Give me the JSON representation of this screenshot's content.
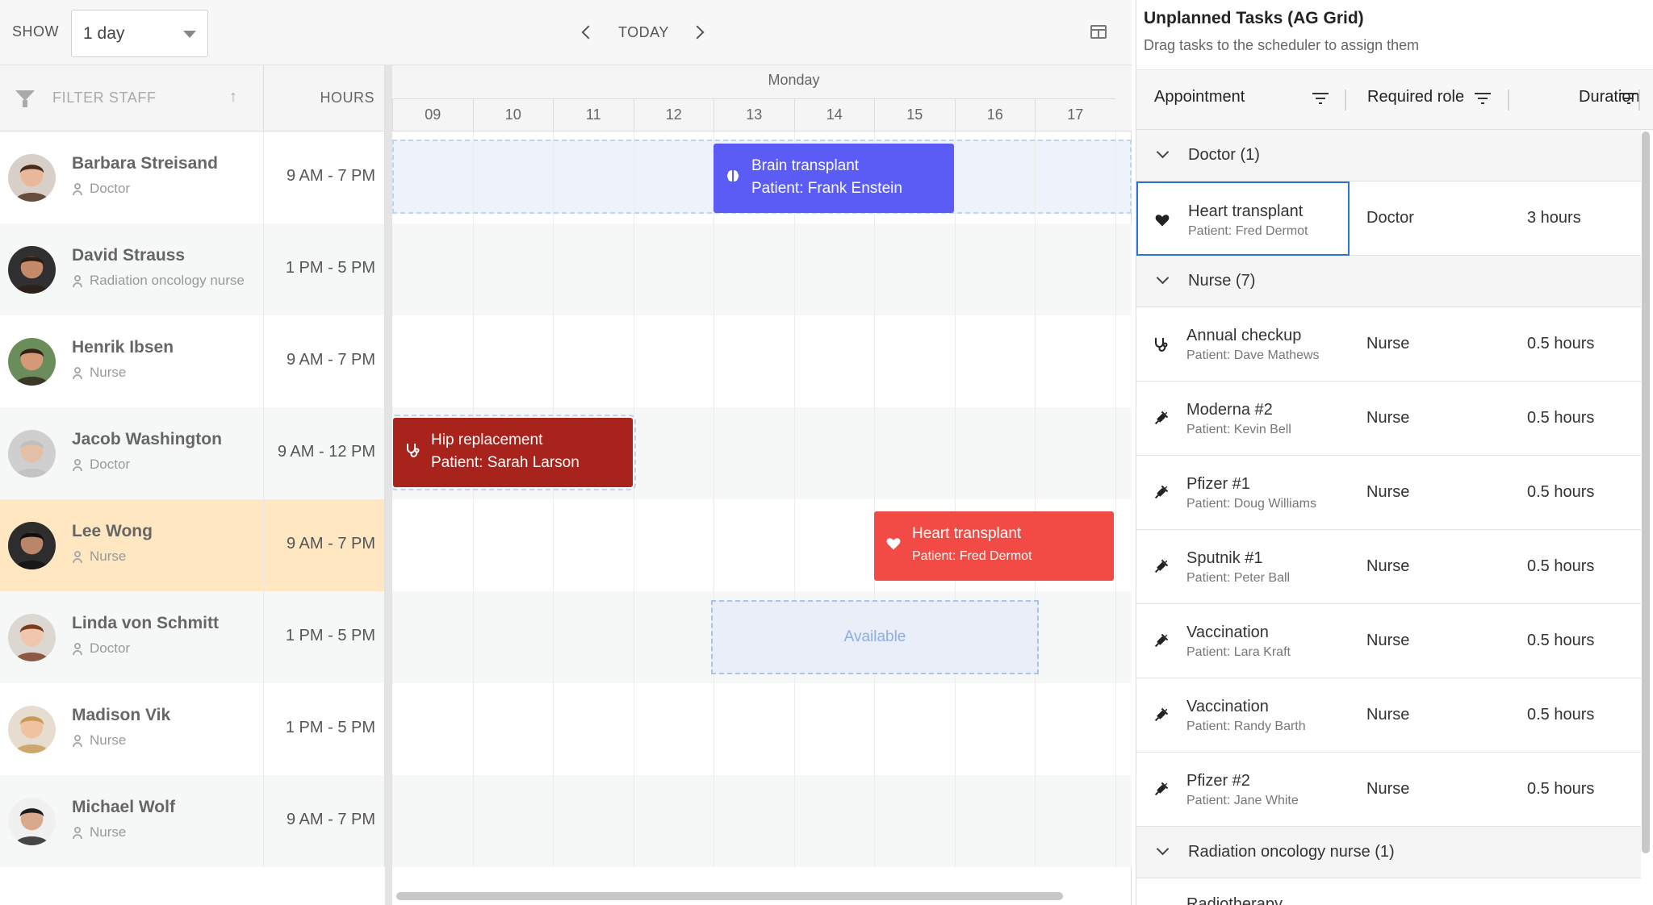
{
  "toolbar": {
    "show_label": "SHOW",
    "range_value": "1 day",
    "today_label": "TODAY"
  },
  "staff_header": {
    "filter_placeholder": "FILTER STAFF",
    "hours_label": "HOURS"
  },
  "timeline": {
    "day": "Monday",
    "hours": [
      "09",
      "10",
      "11",
      "12",
      "13",
      "14",
      "15",
      "16",
      "17"
    ]
  },
  "staff": [
    {
      "name": "Barbara Streisand",
      "role": "Doctor",
      "hours": "9 AM - 7 PM"
    },
    {
      "name": "David Strauss",
      "role": "Radiation oncology nurse",
      "hours": "1 PM - 5 PM"
    },
    {
      "name": "Henrik Ibsen",
      "role": "Nurse",
      "hours": "9 AM - 7 PM"
    },
    {
      "name": "Jacob Washington",
      "role": "Doctor",
      "hours": "9 AM - 12 PM"
    },
    {
      "name": "Lee Wong",
      "role": "Nurse",
      "hours": "9 AM - 7 PM"
    },
    {
      "name": "Linda von Schmitt",
      "role": "Doctor",
      "hours": "1 PM - 5 PM"
    },
    {
      "name": "Madison Vik",
      "role": "Nurse",
      "hours": "1 PM - 5 PM"
    },
    {
      "name": "Michael Wolf",
      "role": "Nurse",
      "hours": "9 AM - 7 PM"
    }
  ],
  "events": [
    {
      "title": "Brain transplant",
      "patient": "Patient: Frank Enstein",
      "color": "#5b5bf6",
      "icon": "brain-icon"
    },
    {
      "title": "Hip replacement",
      "patient": "Patient: Sarah Larson",
      "color": "#a8231b",
      "icon": "stethoscope-icon"
    },
    {
      "title": "Heart transplant",
      "patient": "Patient: Fred Dermot",
      "color": "#f24b45",
      "icon": "heart-icon"
    }
  ],
  "available_label": "Available",
  "grid": {
    "title": "Unplanned Tasks (AG Grid)",
    "subtitle": "Drag tasks to the scheduler to assign them",
    "columns": [
      "Appointment",
      "Required role",
      "Duration"
    ],
    "groups": [
      {
        "label": "Doctor (1)",
        "tasks": [
          {
            "name": "Heart transplant",
            "patient": "Patient: Fred Dermot",
            "role": "Doctor",
            "duration": "3 hours",
            "icon": "heart-icon"
          }
        ]
      },
      {
        "label": "Nurse (7)",
        "tasks": [
          {
            "name": "Annual checkup",
            "patient": "Patient: Dave Mathews",
            "role": "Nurse",
            "duration": "0.5 hours",
            "icon": "stethoscope-icon"
          },
          {
            "name": "Moderna #2",
            "patient": "Patient: Kevin Bell",
            "role": "Nurse",
            "duration": "0.5 hours",
            "icon": "syringe-icon"
          },
          {
            "name": "Pfizer #1",
            "patient": "Patient: Doug Williams",
            "role": "Nurse",
            "duration": "0.5 hours",
            "icon": "syringe-icon"
          },
          {
            "name": "Sputnik #1",
            "patient": "Patient: Peter Ball",
            "role": "Nurse",
            "duration": "0.5 hours",
            "icon": "syringe-icon"
          },
          {
            "name": "Vaccination",
            "patient": "Patient: Lara Kraft",
            "role": "Nurse",
            "duration": "0.5 hours",
            "icon": "syringe-icon"
          },
          {
            "name": "Vaccination",
            "patient": "Patient: Randy Barth",
            "role": "Nurse",
            "duration": "0.5 hours",
            "icon": "syringe-icon"
          },
          {
            "name": "Pfizer #2",
            "patient": "Patient: Jane White",
            "role": "Nurse",
            "duration": "0.5 hours",
            "icon": "syringe-icon"
          }
        ]
      },
      {
        "label": "Radiation oncology nurse (1)",
        "tasks": []
      }
    ],
    "partial_row_text": "Radiotherapy"
  },
  "colors": {
    "accent_blue": "#2b72d8",
    "selected_row": "#ffe7c2",
    "alt_row": "#f6f8f8"
  }
}
